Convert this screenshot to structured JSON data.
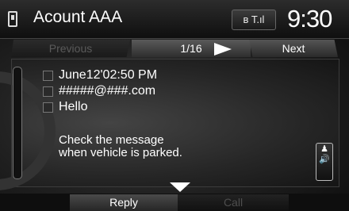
{
  "header": {
    "title": "Acount AAA",
    "status_icons": "ʙ T.ıl",
    "time": "9:30"
  },
  "nav": {
    "previous_label": "Previous",
    "counter": "1/16",
    "next_label": "Next"
  },
  "message": {
    "datetime": "June12'02:50 PM",
    "sender": "#####@###.com",
    "subject": "Hello",
    "body_line1": "Check the message",
    "body_line2": "when vehicle is parked."
  },
  "actions": {
    "reply_label": "Reply",
    "call_label": "Call"
  },
  "icons": {
    "phone": "phone-icon",
    "bluetooth_signal": "bluetooth-signal-icon",
    "speak": "speak-icon"
  }
}
